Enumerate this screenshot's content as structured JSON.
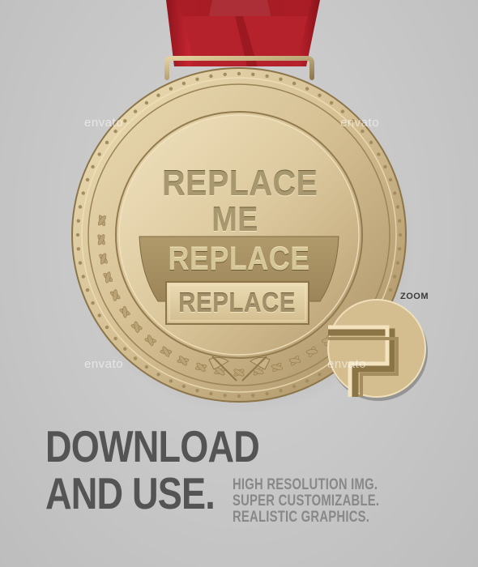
{
  "medal": {
    "line1": "REPLACE",
    "line2": "ME",
    "band_text": "REPLACE",
    "box_text": "REPLACE"
  },
  "zoom": {
    "label": "ZOOM"
  },
  "watermarks": [
    "envato",
    "envato",
    "envato",
    "envato"
  ],
  "headline": {
    "line1": "DOWNLOAD",
    "line2": "AND USE."
  },
  "features": [
    "HIGH RESOLUTION IMG.",
    "SUPER CUSTOMIZABLE.",
    "REALISTIC GRAPHICS."
  ],
  "colors": {
    "ribbon": "#b8202a",
    "gold_light": "#e8d4a8",
    "gold_dark": "#9c8458",
    "headline": "#545454",
    "features": "#888888"
  }
}
